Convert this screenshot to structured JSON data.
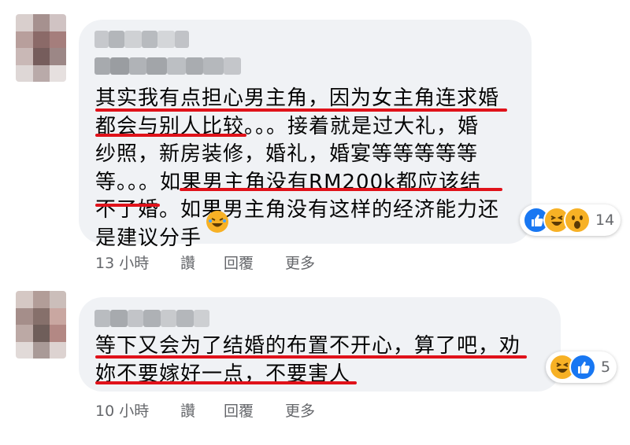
{
  "comments": [
    {
      "text": "其实我有点担心男主角，因为女主角连求婚\n都会与别人比较。。。接着就是过大礼，婚\n纱照，新房装修，婚礼，婚宴等等等等等\n等。。。如果男主角没有RM200k都应该结\n不了婚。如果男主角没有这样的经济能力还\n是建议分手",
      "reaction_count": "14",
      "reaction_icons": [
        "like-icon",
        "haha-icon",
        "wow-icon"
      ],
      "time": "13 小時",
      "like_label": "讚",
      "reply_label": "回覆",
      "more_label": "更多"
    },
    {
      "text": "等下又会为了结婚的布置不开心，算了吧，劝\n妳不要嫁好一点，不要害人",
      "reaction_count": "5",
      "reaction_icons": [
        "haha-icon",
        "like-icon"
      ],
      "time": "10 小時",
      "like_label": "讚",
      "reply_label": "回覆",
      "more_label": "更多"
    }
  ],
  "colors": {
    "bubble": "#f0f2f5",
    "underline": "#e0121a",
    "meta_text": "#65676b",
    "like_blue": "#1877f2",
    "haha_yellow": "#f7b125"
  }
}
